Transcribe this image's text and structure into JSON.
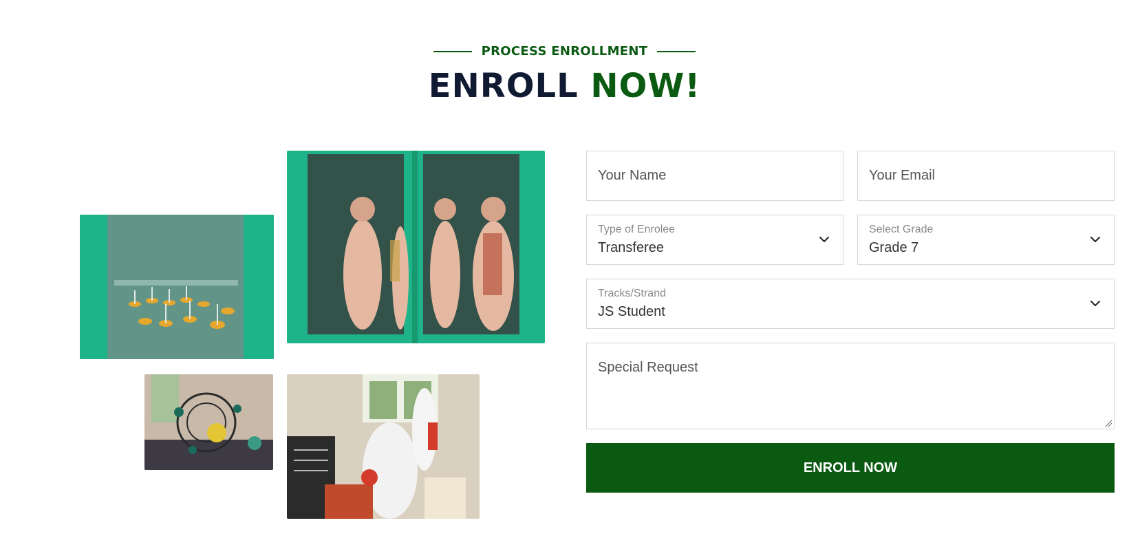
{
  "header": {
    "eyebrow": "PROCESS ENROLLMENT",
    "title_part1": "ENROLL",
    "title_part2": "NOW!"
  },
  "form": {
    "name_placeholder": "Your Name",
    "email_placeholder": "Your Email",
    "enrolee_type": {
      "label": "Type of Enrolee",
      "value": "Transferee"
    },
    "grade": {
      "label": "Select Grade",
      "value": "Grade 7"
    },
    "track": {
      "label": "Tracks/Strand",
      "value": "JS Student"
    },
    "special_request_placeholder": "Special Request",
    "submit_label": "ENROLL NOW"
  },
  "icons": {
    "dropdown": "chevron-down-icon",
    "resize": "resize-grip-icon"
  },
  "colors": {
    "brand_green": "#0b5a12",
    "title_dark": "#111a33",
    "cabinet_teal": "#1fb38a",
    "field_border": "#d7d7d7"
  }
}
